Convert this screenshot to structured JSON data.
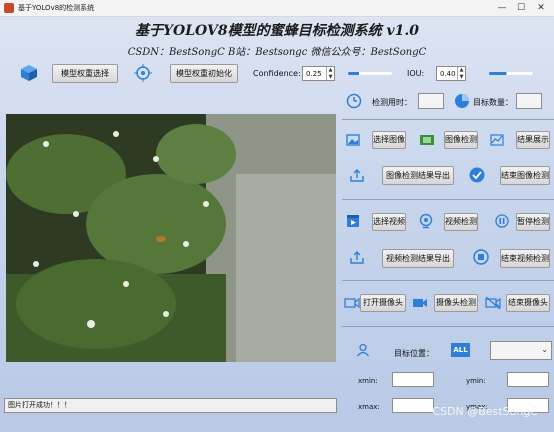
{
  "window": {
    "title": "基于YOLOv8的检测系统",
    "minimize": "—",
    "maximize": "☐",
    "close": "✕"
  },
  "header": {
    "title": "基于YOLOV8模型的蜜蜂目标检测系统 v1.0",
    "subtitle": "CSDN：BestSongC   B站：Bestsongc   微信公众号：BestSongC"
  },
  "toolbar": {
    "weight_select": "模型权重选择",
    "weight_init": "模型权重初始化",
    "confidence_label": "Confidence:",
    "confidence_value": "0.25",
    "iou_label": "IOU:",
    "iou_value": "0.40",
    "confidence_slider_level": 0.25,
    "iou_slider_level": 0.4
  },
  "stats": {
    "time_label": "检测用时：",
    "time_value": "",
    "count_label": "目标数量：",
    "count_value": ""
  },
  "image": {
    "select": "选择图像",
    "detect": "图像检测",
    "show": "结果展示",
    "export": "图像检测结果导出",
    "end": "结束图像检测"
  },
  "video": {
    "select": "选择视频",
    "detect": "视频检测",
    "pause": "暂停检测",
    "export": "视频检测结果导出",
    "end": "结束视频检测"
  },
  "camera": {
    "open": "打开摄像头",
    "detect": "摄像头检测",
    "end": "结束摄像头"
  },
  "target": {
    "label": "目标位置：",
    "all_badge": "ALL",
    "select_value": "",
    "xmin": "xmin:",
    "ymin": "ymin:",
    "xmax": "xmax:",
    "ymax": "ymax:"
  },
  "status": {
    "message": "图片打开成功！！！"
  },
  "watermark": "CSDN @BestSongC",
  "icons": [
    "cube-icon",
    "target-icon",
    "clock-icon",
    "pie-icon",
    "image-icon",
    "scan-icon",
    "chart-icon",
    "upload-icon",
    "check-icon",
    "video-file-icon",
    "camera-lens-icon",
    "pause-icon",
    "stop-icon",
    "webcam-icon",
    "person-icon"
  ],
  "colors": {
    "accent": "#2f7fd8",
    "background": "#c9d6ec"
  }
}
